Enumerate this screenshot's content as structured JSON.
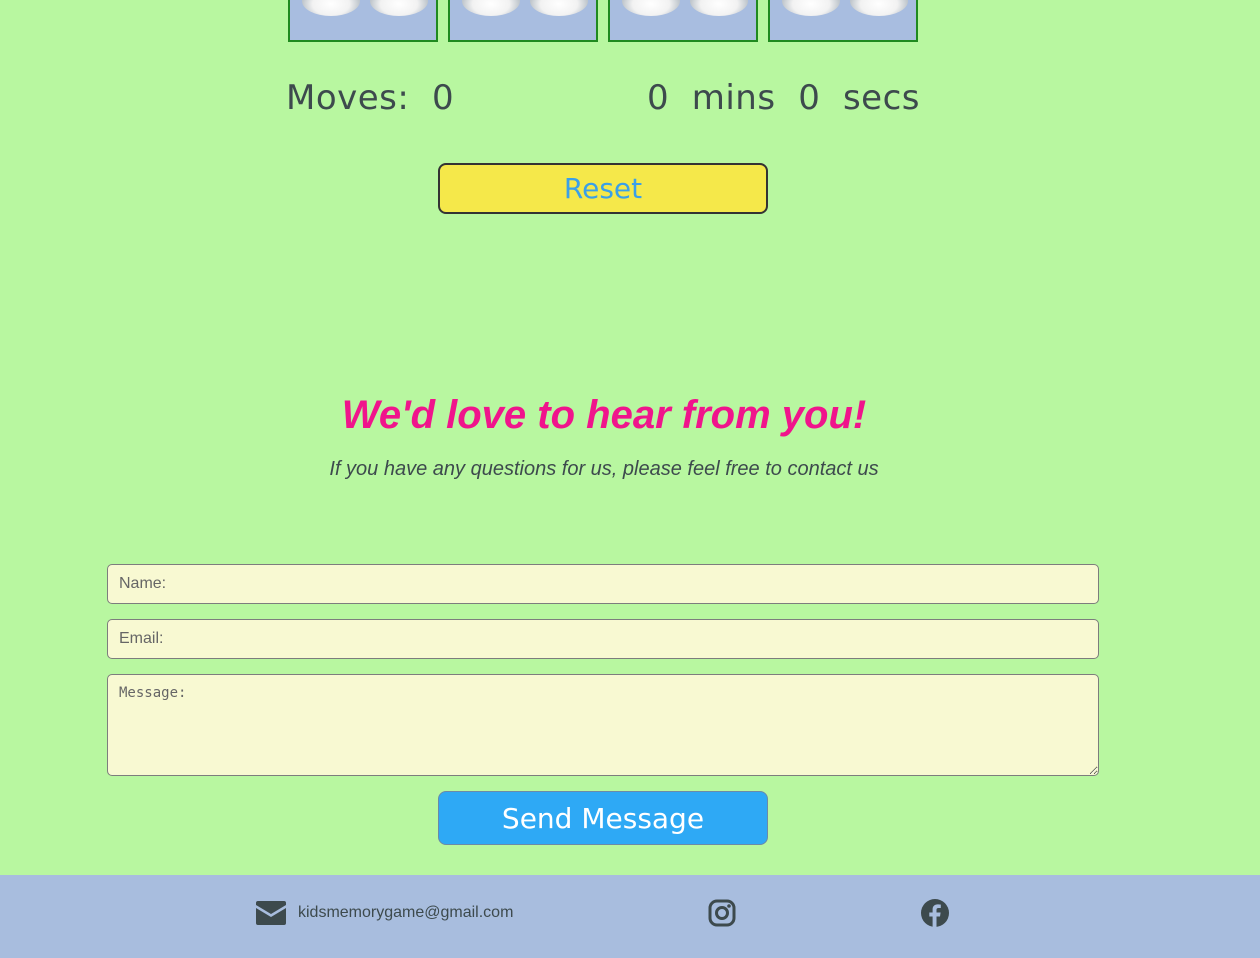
{
  "game": {
    "moves_label": "Moves:",
    "moves_value": "0",
    "timer_mins": "0",
    "mins_label": "mins",
    "timer_secs": "0",
    "secs_label": "secs",
    "reset_label": "Reset",
    "card_count": 4
  },
  "contact": {
    "title": "We'd love to hear from you!",
    "subtitle": "If you have any questions for us, please feel free to contact us",
    "name_placeholder": "Name:",
    "email_placeholder": "Email:",
    "message_placeholder": "Message:",
    "send_label": "Send Message"
  },
  "footer": {
    "email": "kidsmemorygame@gmail.com",
    "icons": [
      "envelope-icon",
      "instagram-icon",
      "facebook-icon"
    ]
  },
  "colors": {
    "page_bg": "#b8f7a0",
    "card_bg": "#a8bde0",
    "reset_bg": "#f5e84a",
    "reset_text": "#3aa0e8",
    "title_pink": "#f0148c",
    "send_bg": "#2ea9f5",
    "footer_bg": "#a8bdde",
    "text_dark": "#3d4a4d"
  }
}
